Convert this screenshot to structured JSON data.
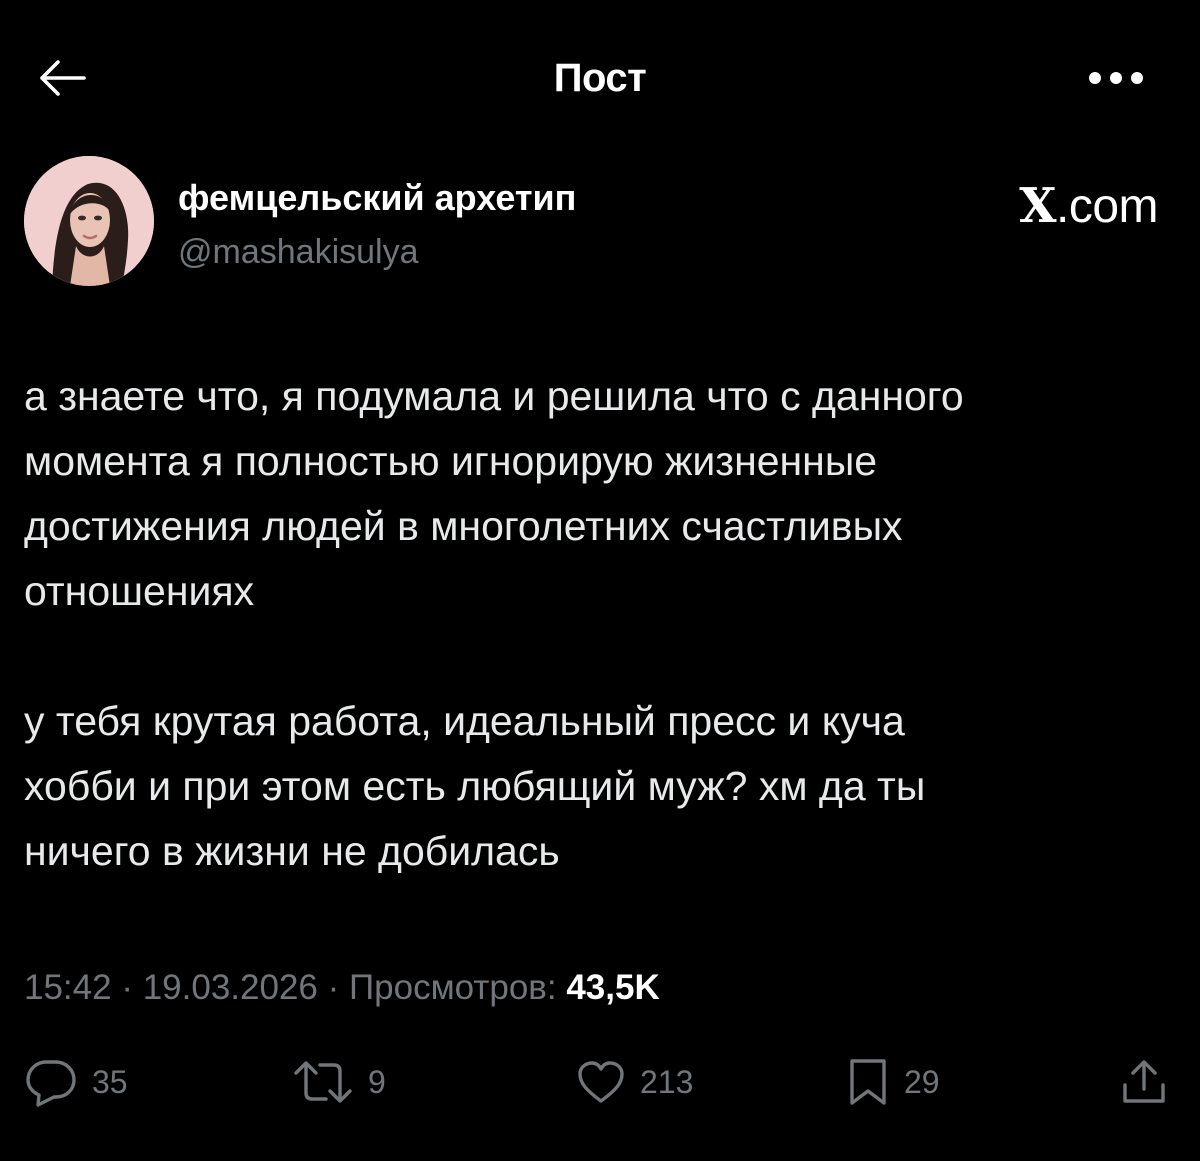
{
  "header": {
    "title": "Пост",
    "back_icon": "arrow-left-icon",
    "more_icon": "more-horizontal-icon"
  },
  "author": {
    "display_name": "фемцельский архетип",
    "handle": "@mashakisulya",
    "avatar_icon": "avatar-photo"
  },
  "watermark": {
    "x": "X",
    "rest": ".com"
  },
  "tweet": {
    "text": "а знаете что, я подумала и решила что с данного\nмомента я полностью игнорирую жизненные\nдостижения людей в многолетних счастливых\nотношениях\n\nу тебя крутая работа, идеальный пресс и куча\nхобби и при этом есть любящий муж? хм да ты\nничего в жизни не добилась"
  },
  "meta": {
    "time": "15:42",
    "separator": " · ",
    "date": "19.03.2026",
    "views_label": "Просмотров: ",
    "views_count": "43,5K"
  },
  "actions": {
    "reply": {
      "icon": "reply-icon",
      "count": "35"
    },
    "repost": {
      "icon": "repost-icon",
      "count": "9"
    },
    "like": {
      "icon": "heart-icon",
      "count": "213"
    },
    "bookmark": {
      "icon": "bookmark-icon",
      "count": "29"
    },
    "share": {
      "icon": "share-icon"
    }
  },
  "colors": {
    "background": "#000000",
    "primary_text": "#e7e9ea",
    "secondary_text": "#71767b",
    "avatar_bg": "#f0c9c9"
  }
}
